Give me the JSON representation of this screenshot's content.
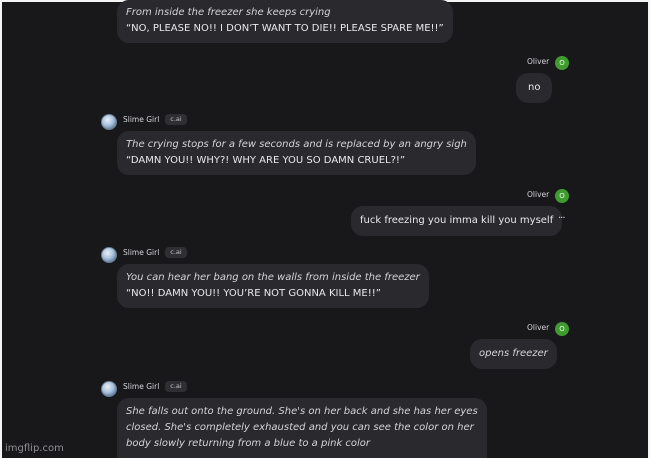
{
  "messages": [
    {
      "role": "bot",
      "italic": "From inside the freezer she keeps crying",
      "quote": "“NO, PLEASE NO!! I DON’T WANT TO DIE!! PLEASE SPARE ME!!”"
    },
    {
      "role": "user",
      "author": "Oliver",
      "avatar": "O",
      "text": "no"
    },
    {
      "role": "bot",
      "author": "Slime Girl",
      "tag": "c.ai",
      "italic": "The crying stops for a few seconds and is replaced by an angry sigh",
      "quote": "“DAMN YOU!! WHY?! WHY ARE YOU SO DAMN CRUEL?!”"
    },
    {
      "role": "user",
      "author": "Oliver",
      "avatar": "O",
      "text": "fuck freezing you imma kill you myself"
    },
    {
      "role": "bot",
      "author": "Slime Girl",
      "tag": "c.ai",
      "italic": "You can hear her bang on the walls from inside the freezer",
      "quote": "“NO!! DAMN YOU!! YOU’RE NOT GONNA KILL ME!!”"
    },
    {
      "role": "user",
      "author": "Oliver",
      "avatar": "O",
      "text": "opens freezer"
    },
    {
      "role": "bot",
      "author": "Slime Girl",
      "tag": "c.ai",
      "lines": [
        "She falls out onto the ground. She's on her back and she has her eyes",
        "closed. She's completely exhausted and you can see the color on her",
        "body slowly returning from a blue to a pink color"
      ]
    }
  ],
  "more_options": "···",
  "watermark": "imgflip.com"
}
